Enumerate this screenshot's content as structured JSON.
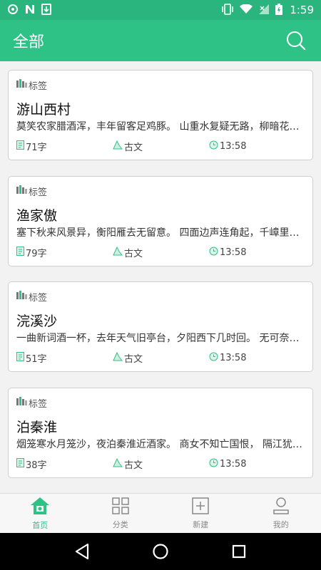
{
  "statusbar": {
    "time": "1:59",
    "colors": {
      "bg": "#2bb57e"
    }
  },
  "appbar": {
    "title": "全部",
    "search_icon": "search-icon"
  },
  "cards": [
    {
      "tag": "标签",
      "title": "游山西村",
      "excerpt": "莫笑农家腊酒浑，丰年留客足鸡豚。 山重水复疑无路，柳暗花明又一村。",
      "count": "71字",
      "category": "古文",
      "time": "13:58"
    },
    {
      "tag": "标签",
      "title": "渔家傲",
      "excerpt": "塞下秋来风景异，衡阳雁去无留意。 四面边声连角起，千嶂里，长烟落日孤城闭。",
      "count": "79字",
      "category": "古文",
      "time": "13:58"
    },
    {
      "tag": "标签",
      "title": "浣溪沙",
      "excerpt": "一曲新词酒一杯，去年天气旧亭台，夕阳西下几时回。 无可奈何花落去。",
      "count": "51字",
      "category": "古文",
      "time": "13:58"
    },
    {
      "tag": "标签",
      "title": "泊秦淮",
      "excerpt": "烟笼寒水月笼沙，夜泊秦淮近酒家。 商女不知亡国恨， 隔江犹唱后庭花。",
      "count": "38字",
      "category": "古文",
      "time": "13:58"
    }
  ],
  "tabs": [
    {
      "label": "首页",
      "icon": "home-icon",
      "active": true
    },
    {
      "label": "分类",
      "icon": "grid-icon",
      "active": false
    },
    {
      "label": "新建",
      "icon": "add-box-icon",
      "active": false
    },
    {
      "label": "我的",
      "icon": "profile-icon",
      "active": false
    }
  ],
  "colors": {
    "accent": "#2ec286",
    "tab_inactive": "#888888"
  }
}
